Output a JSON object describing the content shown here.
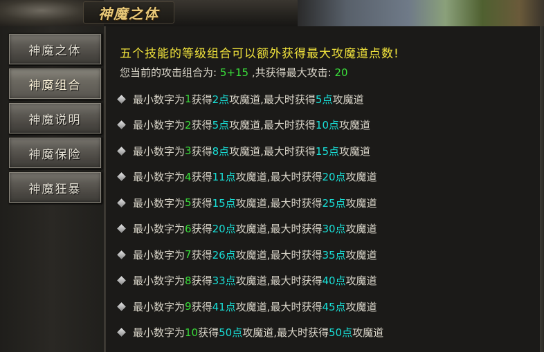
{
  "window": {
    "title": "神魔之体"
  },
  "sidebar": {
    "items": [
      {
        "label": "神魔之体",
        "active": false
      },
      {
        "label": "神魔组合",
        "active": true
      },
      {
        "label": "神魔说明",
        "active": false
      },
      {
        "label": "神魔保险",
        "active": false
      },
      {
        "label": "神魔狂暴",
        "active": false
      }
    ]
  },
  "main": {
    "heading": "五个技能的等级组合可以额外获得最大攻魔道点数!",
    "combo_prefix": "您当前的攻击组合为:",
    "combo_value": "5+15",
    "combo_mid": ",共获得最大攻击:",
    "combo_total": "20",
    "rules": [
      {
        "p1": "最小数字为",
        "n": "1",
        "p2": "获得",
        "pts": "2点",
        "p3": "攻魔道,最大时获得",
        "max": "5点",
        "p4": "攻魔道"
      },
      {
        "p1": "最小数字为",
        "n": "2",
        "p2": "获得",
        "pts": "5点",
        "p3": "攻魔道,最大时获得",
        "max": "10点",
        "p4": "攻魔道"
      },
      {
        "p1": "最小数字为",
        "n": "3",
        "p2": "获得",
        "pts": "8点",
        "p3": "攻魔道,最大时获得",
        "max": "15点",
        "p4": "攻魔道"
      },
      {
        "p1": "最小数字为",
        "n": "4",
        "p2": "获得",
        "pts": "11点",
        "p3": "攻魔道,最大时获得",
        "max": "20点",
        "p4": "攻魔道"
      },
      {
        "p1": "最小数字为",
        "n": "5",
        "p2": "获得",
        "pts": "15点",
        "p3": "攻魔道,最大时获得",
        "max": "25点",
        "p4": "攻魔道"
      },
      {
        "p1": "最小数字为",
        "n": "6",
        "p2": "获得",
        "pts": "20点",
        "p3": "攻魔道,最大时获得",
        "max": "30点",
        "p4": "攻魔道"
      },
      {
        "p1": "最小数字为",
        "n": "7",
        "p2": "获得",
        "pts": "26点",
        "p3": "攻魔道,最大时获得",
        "max": "35点",
        "p4": "攻魔道"
      },
      {
        "p1": "最小数字为",
        "n": "8",
        "p2": "获得",
        "pts": "33点",
        "p3": "攻魔道,最大时获得",
        "max": "40点",
        "p4": "攻魔道"
      },
      {
        "p1": "最小数字为",
        "n": "9",
        "p2": "获得",
        "pts": "41点",
        "p3": "攻魔道,最大时获得",
        "max": "45点",
        "p4": "攻魔道"
      },
      {
        "p1": "最小数字为",
        "n": "10",
        "p2": "获得",
        "pts": "50点",
        "p3": "攻魔道,最大时获得",
        "max": "50点",
        "p4": "攻魔道"
      }
    ]
  },
  "colors": {
    "heading": "#f0e23c",
    "number_green": "#3adf3a",
    "points_cyan": "#19e0d8",
    "text": "#d8d4c8"
  },
  "icons": {
    "bullet": "diamond-bullet-icon"
  }
}
